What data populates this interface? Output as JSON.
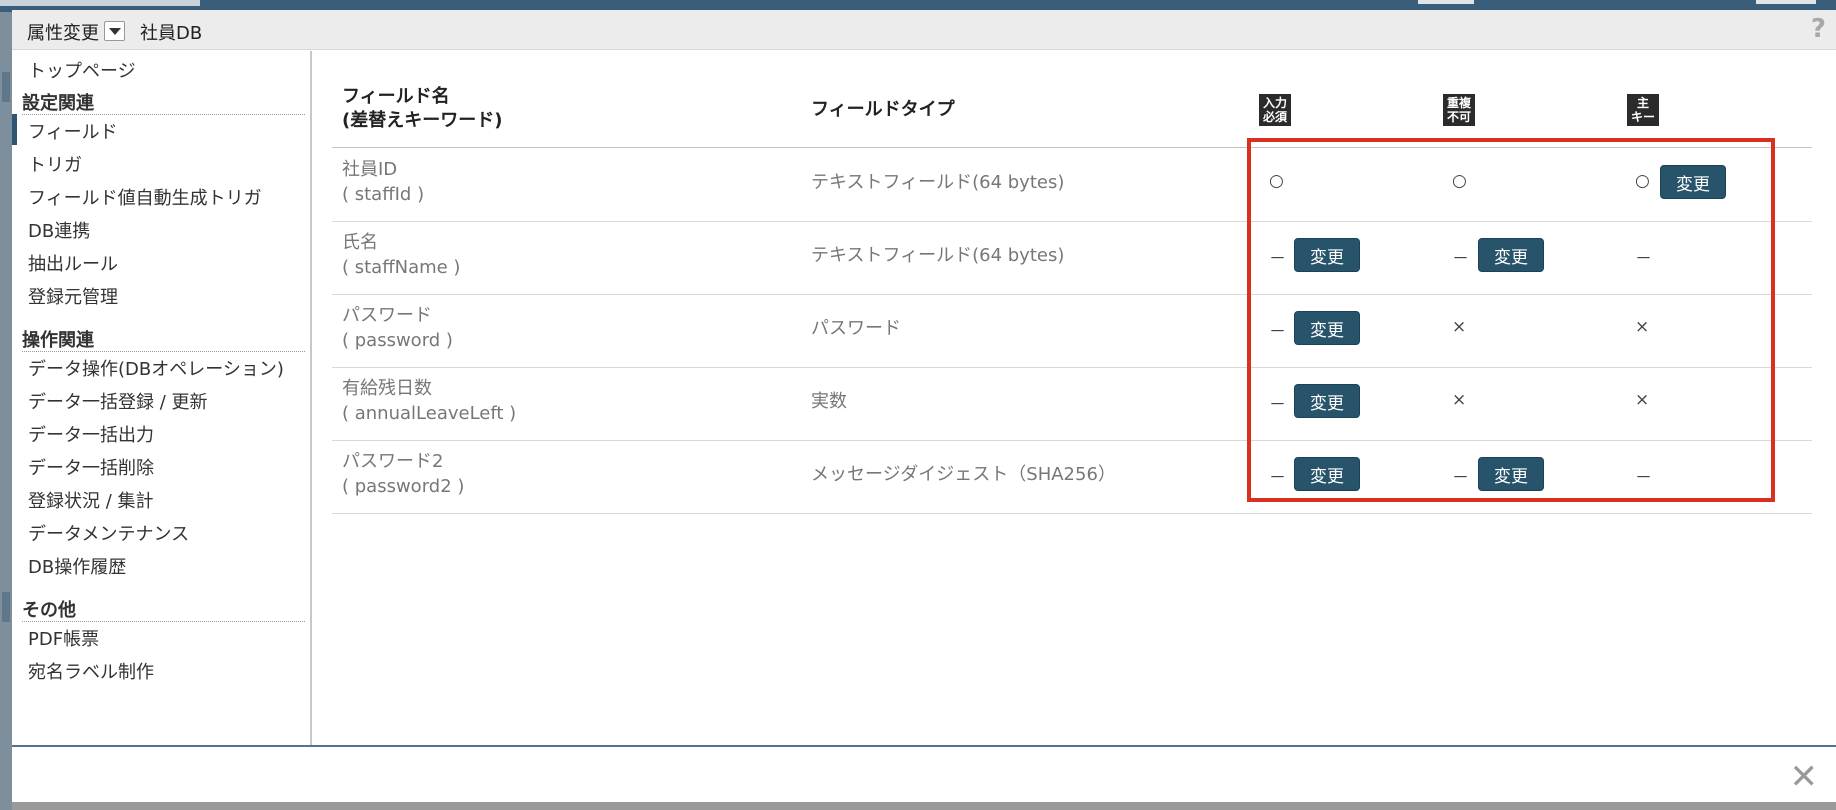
{
  "header": {
    "attr_change_label": "属性変更",
    "db_name": "社員DB",
    "help_glyph": "?"
  },
  "sidebar": {
    "top": "トップページ",
    "sections": [
      {
        "title": "設定関連",
        "items": [
          "フィールド",
          "トリガ",
          "フィールド値自動生成トリガ",
          "DB連携",
          "抽出ルール",
          "登録元管理"
        ]
      },
      {
        "title": "操作関連",
        "items": [
          "データ操作(DBオペレーション)",
          "データ一括登録 / 更新",
          "データ一括出力",
          "データ一括削除",
          "登録状況 / 集計",
          "データメンテナンス",
          "DB操作履歴"
        ]
      },
      {
        "title": "その他",
        "items": [
          "PDF帳票",
          "宛名ラベル制作"
        ]
      }
    ],
    "active_item": "フィールド"
  },
  "table": {
    "col_field_name": "フィールド名",
    "col_field_name_sub": "(差替えキーワード)",
    "col_field_type": "フィールドタイプ",
    "icon_required": [
      "入力",
      "必須"
    ],
    "icon_unique": [
      "重複",
      "不可"
    ],
    "icon_primary": [
      "主",
      "キー"
    ],
    "button_label": "変更",
    "rows": [
      {
        "name": "社員ID",
        "key": "( staffId )",
        "type": "テキストフィールド(64 bytes)",
        "required": "○",
        "unique": "○",
        "primary": "○"
      },
      {
        "name": "氏名",
        "key": "( staffName )",
        "type": "テキストフィールド(64 bytes)",
        "required": "－",
        "unique": "－",
        "primary": "－"
      },
      {
        "name": "パスワード",
        "key": "( password )",
        "type": "パスワード",
        "required": "－",
        "unique": "×",
        "primary": "×"
      },
      {
        "name": "有給残日数",
        "key": "( annualLeaveLeft )",
        "type": "実数",
        "required": "－",
        "unique": "×",
        "primary": "×"
      },
      {
        "name": "パスワード2",
        "key": "( password2 )",
        "type": "メッセージダイジェスト（SHA256）",
        "required": "－",
        "unique": "－",
        "primary": "－"
      }
    ]
  },
  "footer": {
    "close_glyph": "✕"
  },
  "colors": {
    "accent": "#27536b",
    "highlight": "#d93020",
    "header_bg": "#ececec"
  }
}
